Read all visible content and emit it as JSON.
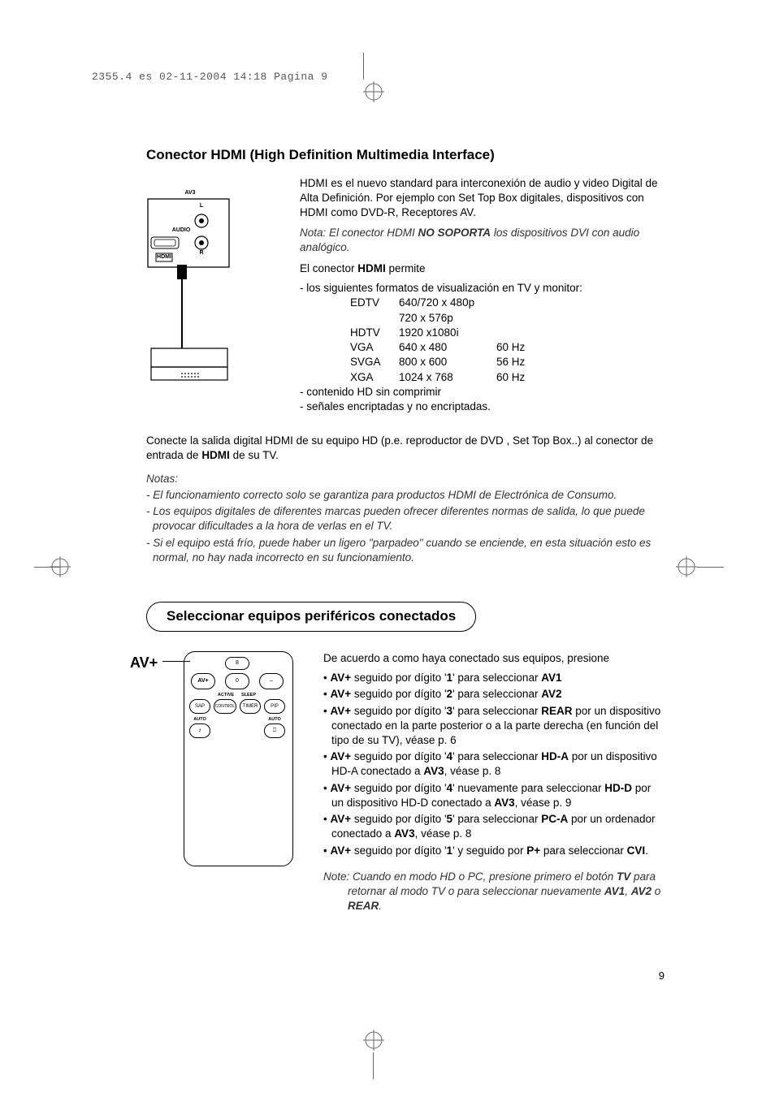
{
  "header": "2355.4 es  02-11-2004  14:18  Pagina 9",
  "page_number": "9",
  "hdmi": {
    "title": "Conector HDMI (High Definition Multimedia Interface)",
    "diagram": {
      "av3": "AV3",
      "l": "L",
      "audio": "AUDIO",
      "r": "R",
      "hdmi": "HDMI"
    },
    "intro": "HDMI es el nuevo standard para interconexión de audio y video Digital de Alta Definición. Por ejemplo con Set Top Box digitales, dispositivos con HDMI como DVD-R, Receptores AV.",
    "note_bold_pre": "Nota: El conector HDMI ",
    "note_bold": "NO SOPORTA",
    "note_bold_post": " los dispositivos DVI con audio analógico.",
    "permite_pre": "El conector ",
    "permite_bold": "HDMI",
    "permite_post": " permite",
    "formats_intro": "- los siguientes formatos de visualización en TV y monitor:",
    "rows": [
      {
        "a": "EDTV",
        "b": "640/720 x 480p",
        "c": ""
      },
      {
        "a": "",
        "b": "720 x 576p",
        "c": ""
      },
      {
        "a": "HDTV",
        "b": "1920 x1080i",
        "c": ""
      },
      {
        "a": "VGA",
        "b": "640 x 480",
        "c": "60 Hz"
      },
      {
        "a": "SVGA",
        "b": "800 x 600",
        "c": "56 Hz"
      },
      {
        "a": "XGA",
        "b": "1024 x 768",
        "c": "60 Hz"
      }
    ],
    "line_hd": "- contenido HD sin comprimir",
    "line_enc": "- señales encriptadas y no encriptadas.",
    "connect_p1": "Conecte la salida digital HDMI de su equipo HD (p.e. reproductor de DVD , Set Top Box..) al conector de entrada de ",
    "connect_bold": "HDMI",
    "connect_p2": " de su TV.",
    "notes_title": "Notas:",
    "notes": [
      "- El funcionamiento correcto solo se garantiza para productos HDMI de Electrónica de Consumo.",
      "- Los equipos digitales de diferentes marcas pueden ofrecer diferentes normas de salida, lo que puede provocar dificultades a la hora de verlas en el TV.",
      "- Si el equipo está frío, puede haber un ligero \"parpadeo\" cuando se enciende, en esta situación esto es normal, no hay nada incorrecto en su funcionamiento."
    ]
  },
  "periph": {
    "title": "Seleccionar equipos periféricos conectados",
    "avplus": "AV+",
    "remote": {
      "b8": "8",
      "b0": "0",
      "dash": "–",
      "avplus": "AV+",
      "active": "ACTIVE",
      "sleep": "SLEEP",
      "sap": "SAP",
      "control": "CONTROL",
      "timer": "TIMER",
      "pip": "PIP",
      "auto_up": "AUTO",
      "auto_dn": "AUTO",
      "music": "♪",
      "cc": "⎕"
    },
    "intro": "De acuerdo a como haya conectado sus equipos, presione",
    "items": [
      {
        "pre": "",
        "b1": "AV+",
        "mid": " seguido por dígito '",
        "b2": "1",
        "mid2": "' para seleccionar ",
        "b3": "AV1",
        "post": ""
      },
      {
        "pre": "",
        "b1": "AV+",
        "mid": " seguido por dígito '",
        "b2": "2",
        "mid2": "' para seleccionar ",
        "b3": "AV2",
        "post": ""
      },
      {
        "pre": "",
        "b1": "AV+",
        "mid": " seguido por dígito '",
        "b2": "3",
        "mid2": "' para seleccionar ",
        "b3": "REAR",
        "post": " por un dispositivo conectado en la parte posterior o a la parte derecha (en función del tipo de su TV), véase p. 6"
      },
      {
        "pre": "",
        "b1": "AV+",
        "mid": " seguido por dígito '",
        "b2": "4",
        "mid2": "' para seleccionar ",
        "b3": "HD-A",
        "post": " por un dispositivo HD-A conectado a ",
        "b4": "AV3",
        "post2": ", véase p. 8"
      },
      {
        "pre": "",
        "b1": "AV+",
        "mid": " seguido por dígito '",
        "b2": "4",
        "mid2": "' nuevamente para seleccionar ",
        "b3": "HD-D",
        "post": " por un dispositivo HD-D conectado a ",
        "b4": "AV3",
        "post2": ", véase p. 9"
      },
      {
        "pre": "",
        "b1": "AV+",
        "mid": " seguido por dígito '",
        "b2": "5",
        "mid2": "' para seleccionar ",
        "b3": "PC-A",
        "post": " por un ordenador conectado a ",
        "b4": "AV3",
        "post2": ", véase p. 8"
      },
      {
        "pre": "",
        "b1": "AV+",
        "mid": " seguido por dígito '",
        "b2": "1",
        "mid2": "' y seguido por ",
        "b3": "P+",
        "post": " para seleccionar ",
        "b4": "CVI",
        "post2": "."
      }
    ],
    "note_pre": "Note: Cuando en modo HD o PC, presione primero el botón ",
    "note_b1": "TV",
    "note_mid": " para retornar al modo TV o para seleccionar nuevamente ",
    "note_b2": "AV1",
    "note_sep1": ", ",
    "note_b3": "AV2",
    "note_sep2": " o ",
    "note_b4": "REAR",
    "note_end": "."
  }
}
